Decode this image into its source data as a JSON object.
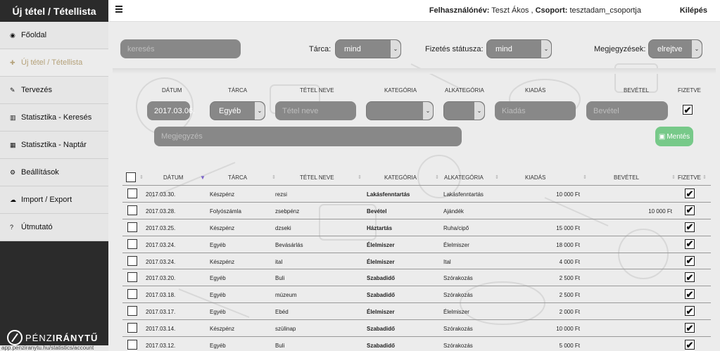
{
  "brand": {
    "title": "Új tétel / Tétellista"
  },
  "topbar": {
    "user_label": "Felhasználónév:",
    "user_name": "Teszt Ákos ,",
    "group_label": "Csoport:",
    "group_name": "tesztadam_csoportja",
    "logout": "Kilépés"
  },
  "menu": [
    {
      "label": "Főoldal",
      "icon": "dashboard-icon",
      "glyph": "◉"
    },
    {
      "label": "Új tétel / Tétellista",
      "icon": "plus-icon",
      "glyph": "✚"
    },
    {
      "label": "Tervezés",
      "icon": "pencil-icon",
      "glyph": "✎"
    },
    {
      "label": "Statisztika - Keresés",
      "icon": "bar-chart-icon",
      "glyph": "▥"
    },
    {
      "label": "Statisztika - Naptár",
      "icon": "calendar-icon",
      "glyph": "▦"
    },
    {
      "label": "Beállítások",
      "icon": "cogs-icon",
      "glyph": "⚙"
    },
    {
      "label": "Import / Export",
      "icon": "cloud-upload-icon",
      "glyph": "☁"
    },
    {
      "label": "Útmutató",
      "icon": "question-icon",
      "glyph": "?"
    }
  ],
  "logo": {
    "part1": "PÉNZ",
    "part2": "IRÁNYTŰ"
  },
  "status_url": "app.penziranytu.hu/statistics/account",
  "filters": {
    "search_placeholder": "keresés",
    "wallet_label": "Tárca:",
    "wallet_value": "mind",
    "payment_label": "Fizetés státusza:",
    "payment_value": "mind",
    "notes_label": "Megjegyzések:",
    "notes_value": "elrejtve"
  },
  "form": {
    "headers": [
      "DÁTUM",
      "TÁRCA",
      "TÉTEL NEVE",
      "KATEGÓRIA",
      "ALKATEGÓRIA",
      "KIADÁS",
      "BEVÉTEL",
      "FIZETVE"
    ],
    "date_value": "2017.03.06.",
    "wallet_value": "Egyéb",
    "item_placeholder": "Tétel neve",
    "expense_placeholder": "Kiadás",
    "income_placeholder": "Bevétel",
    "note_placeholder": "Megjegyzés",
    "save_label": "Mentés",
    "paid_checked": true
  },
  "table": {
    "columns": [
      "DÁTUM",
      "TÁRCA",
      "TÉTEL NEVE",
      "KATEGÓRIA",
      "ALKATEGÓRIA",
      "KIADÁS",
      "BEVÉTEL",
      "FIZETVE"
    ],
    "rows": [
      {
        "date": "2017.03.30.",
        "wallet": "Készpénz",
        "name": "rezsi",
        "category": "Lakásfenntartás",
        "subcategory": "Lakásfenntartás",
        "expense": "10 000 Ft",
        "income": "",
        "paid": true
      },
      {
        "date": "2017.03.28.",
        "wallet": "Folyószámla",
        "name": "zsebpénz",
        "category": "Bevétel",
        "subcategory": "Ajándék",
        "expense": "",
        "income": "10 000 Ft",
        "paid": true
      },
      {
        "date": "2017.03.25.",
        "wallet": "Készpénz",
        "name": "dzseki",
        "category": "Háztartás",
        "subcategory": "Ruha/cipő",
        "expense": "15 000 Ft",
        "income": "",
        "paid": true
      },
      {
        "date": "2017.03.24.",
        "wallet": "Egyéb",
        "name": "Bevásárlás",
        "category": "Élelmiszer",
        "subcategory": "Élelmiszer",
        "expense": "18 000 Ft",
        "income": "",
        "paid": true
      },
      {
        "date": "2017.03.24.",
        "wallet": "Készpénz",
        "name": "ital",
        "category": "Élelmiszer",
        "subcategory": "Ital",
        "expense": "4 000 Ft",
        "income": "",
        "paid": true
      },
      {
        "date": "2017.03.20.",
        "wallet": "Egyéb",
        "name": "Buli",
        "category": "Szabadidő",
        "subcategory": "Szórakozás",
        "expense": "2 500 Ft",
        "income": "",
        "paid": true
      },
      {
        "date": "2017.03.18.",
        "wallet": "Egyéb",
        "name": "múzeum",
        "category": "Szabadidő",
        "subcategory": "Szórakozás",
        "expense": "2 500 Ft",
        "income": "",
        "paid": true
      },
      {
        "date": "2017.03.17.",
        "wallet": "Egyéb",
        "name": "Ebéd",
        "category": "Élelmiszer",
        "subcategory": "Élelmiszer",
        "expense": "2 000 Ft",
        "income": "",
        "paid": true
      },
      {
        "date": "2017.03.14.",
        "wallet": "Készpénz",
        "name": "szülinap",
        "category": "Szabadidő",
        "subcategory": "Szórakozás",
        "expense": "10 000 Ft",
        "income": "",
        "paid": true
      },
      {
        "date": "2017.03.12.",
        "wallet": "Egyéb",
        "name": "Buli",
        "category": "Szabadidő",
        "subcategory": "Szórakozás",
        "expense": "5 000 Ft",
        "income": "",
        "paid": true
      }
    ]
  },
  "colors": {
    "accent": "#b5a27a",
    "save": "#77c989",
    "sidebar": "#2b2b2b",
    "pill": "#888888"
  }
}
